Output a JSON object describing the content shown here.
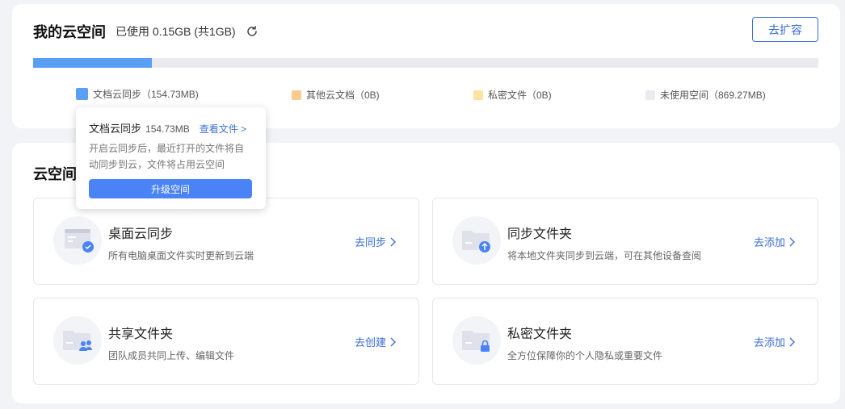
{
  "storage": {
    "title": "我的云空间",
    "usage": "已使用 0.15GB (共1GB)",
    "used_fraction": 0.151,
    "expand_label": "去扩容",
    "legend": [
      {
        "label": "文档云同步（154.73MB)",
        "color": "#5b9ff5",
        "icon": "doc-sync-swatch"
      },
      {
        "label": "其他云文档（0B)",
        "color": "#f9c98f",
        "icon": "other-docs-swatch"
      },
      {
        "label": "私密文件（0B)",
        "color": "#fde3a1",
        "icon": "private-files-swatch"
      },
      {
        "label": "未使用空间（869.27MB)",
        "color": "#ebebef",
        "icon": "unused-space-swatch"
      }
    ]
  },
  "tooltip": {
    "title": "文档云同步",
    "size": "154.73MB",
    "link": "查看文件 >",
    "desc": "开启云同步后，最近打开的文件将自动同步到云，文件将占用云空间",
    "button": "升级空间"
  },
  "cloud_space": {
    "title": "云空间",
    "features": [
      {
        "name": "桌面云同步",
        "desc": "所有电脑桌面文件实时更新到云端",
        "action": "去同步",
        "icon": "desktop-sync-icon"
      },
      {
        "name": "同步文件夹",
        "desc": "将本地文件夹同步到云端，可在其他设备查阅",
        "action": "去添加",
        "icon": "sync-folder-icon"
      },
      {
        "name": "共享文件夹",
        "desc": "团队成员共同上传、编辑文件",
        "action": "去创建",
        "icon": "shared-folder-icon"
      },
      {
        "name": "私密文件夹",
        "desc": "全方位保障你的个人隐私或重要文件",
        "action": "去添加",
        "icon": "private-folder-icon"
      }
    ]
  },
  "colors": {
    "accent": "#3a6fd8",
    "button_fill": "#4a83f5",
    "badge_blue": "#4a83f5"
  }
}
